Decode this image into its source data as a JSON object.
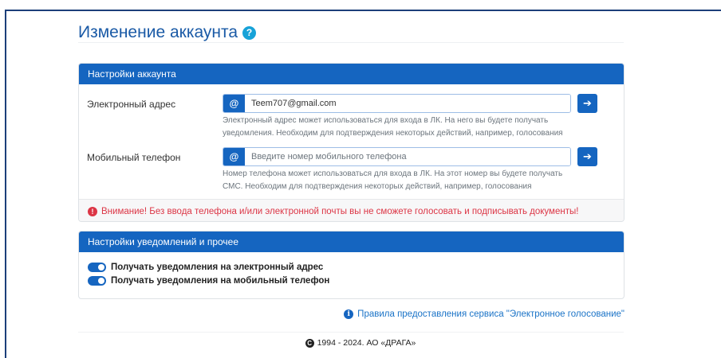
{
  "page": {
    "title": "Изменение аккаунта",
    "help_icon": "question-circle-icon",
    "help_glyph": "?"
  },
  "account_settings": {
    "header": "Настройки аккаунта",
    "email": {
      "label": "Электронный адрес",
      "addon": "@",
      "value": "Teem707@gmail.com",
      "placeholder": "",
      "help": "Электронный адрес может использоваться для входа в ЛК. На него вы будете получать уведомления. Необходим для подтверждения некоторых действий, например, голосования"
    },
    "phone": {
      "label": "Мобильный телефон",
      "addon": "@",
      "value": "",
      "placeholder": "Введите номер мобильного телефона",
      "help": "Номер телефона может использоваться для входа в ЛК. На этот номер вы будете получать СМС. Необходим для подтверждения некоторых действий, например, голосования"
    },
    "submit_glyph": "➔",
    "warning": "Внимание! Без ввода телефона и/или электронной почты вы не сможете голосовать и подписывать документы!",
    "warning_glyph": "!"
  },
  "notification_settings": {
    "header": "Настройки уведомлений и прочее",
    "toggles": [
      {
        "label": "Получать уведомления на электронный адрес",
        "on": true
      },
      {
        "label": "Получать уведомления на мобильный телефон",
        "on": true
      }
    ]
  },
  "rules_link": {
    "text": "Правила предоставления сервиса \"Электронное голосование\"",
    "glyph": "i"
  },
  "footer": {
    "text": "1994 - 2024. АО «ДРАГА»",
    "glyph": "C"
  },
  "colors": {
    "primary": "#1565c0",
    "warning": "#dc3545",
    "title": "#1a5aa6"
  }
}
